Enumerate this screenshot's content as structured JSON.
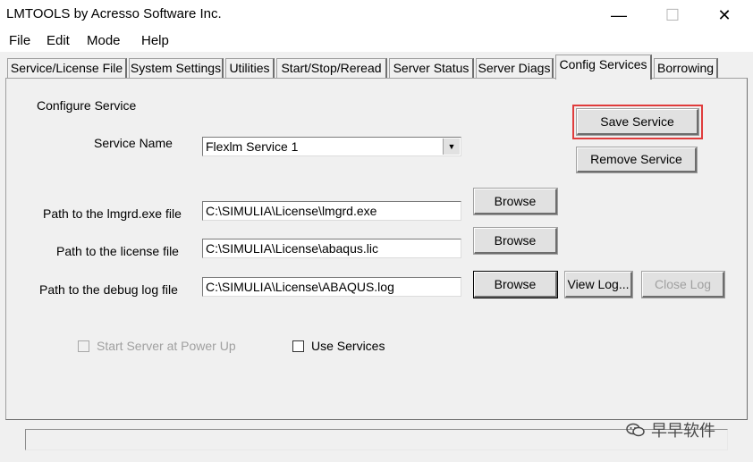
{
  "window": {
    "title": "LMTOOLS by Acresso Software Inc."
  },
  "menu": [
    "File",
    "Edit",
    "Mode",
    "Help"
  ],
  "tabs": [
    {
      "label": "Service/License File"
    },
    {
      "label": "System Settings"
    },
    {
      "label": "Utilities"
    },
    {
      "label": "Start/Stop/Reread"
    },
    {
      "label": "Server Status"
    },
    {
      "label": "Server Diags"
    },
    {
      "label": "Config Services"
    },
    {
      "label": "Borrowing"
    }
  ],
  "active_tab": "Config Services",
  "config": {
    "section_title": "Configure Service",
    "service_name_label": "Service Name",
    "service_name_value": "Flexlm Service 1",
    "lmgrd_label": "Path to the lmgrd.exe file",
    "lmgrd_value": "C:\\SIMULIA\\License\\lmgrd.exe",
    "license_label": "Path to the license file",
    "license_value": "C:\\SIMULIA\\License\\abaqus.lic",
    "debug_label": "Path to the debug log file",
    "debug_value": "C:\\SIMULIA\\License\\ABAQUS.log",
    "save_service": "Save Service",
    "remove_service": "Remove Service",
    "browse": "Browse",
    "view_log": "View Log...",
    "close_log": "Close Log",
    "start_at_power_up": "Start Server at Power Up",
    "use_services": "Use Services"
  },
  "watermark": "早早软件",
  "colors": {
    "highlight": "#e03c3c"
  }
}
